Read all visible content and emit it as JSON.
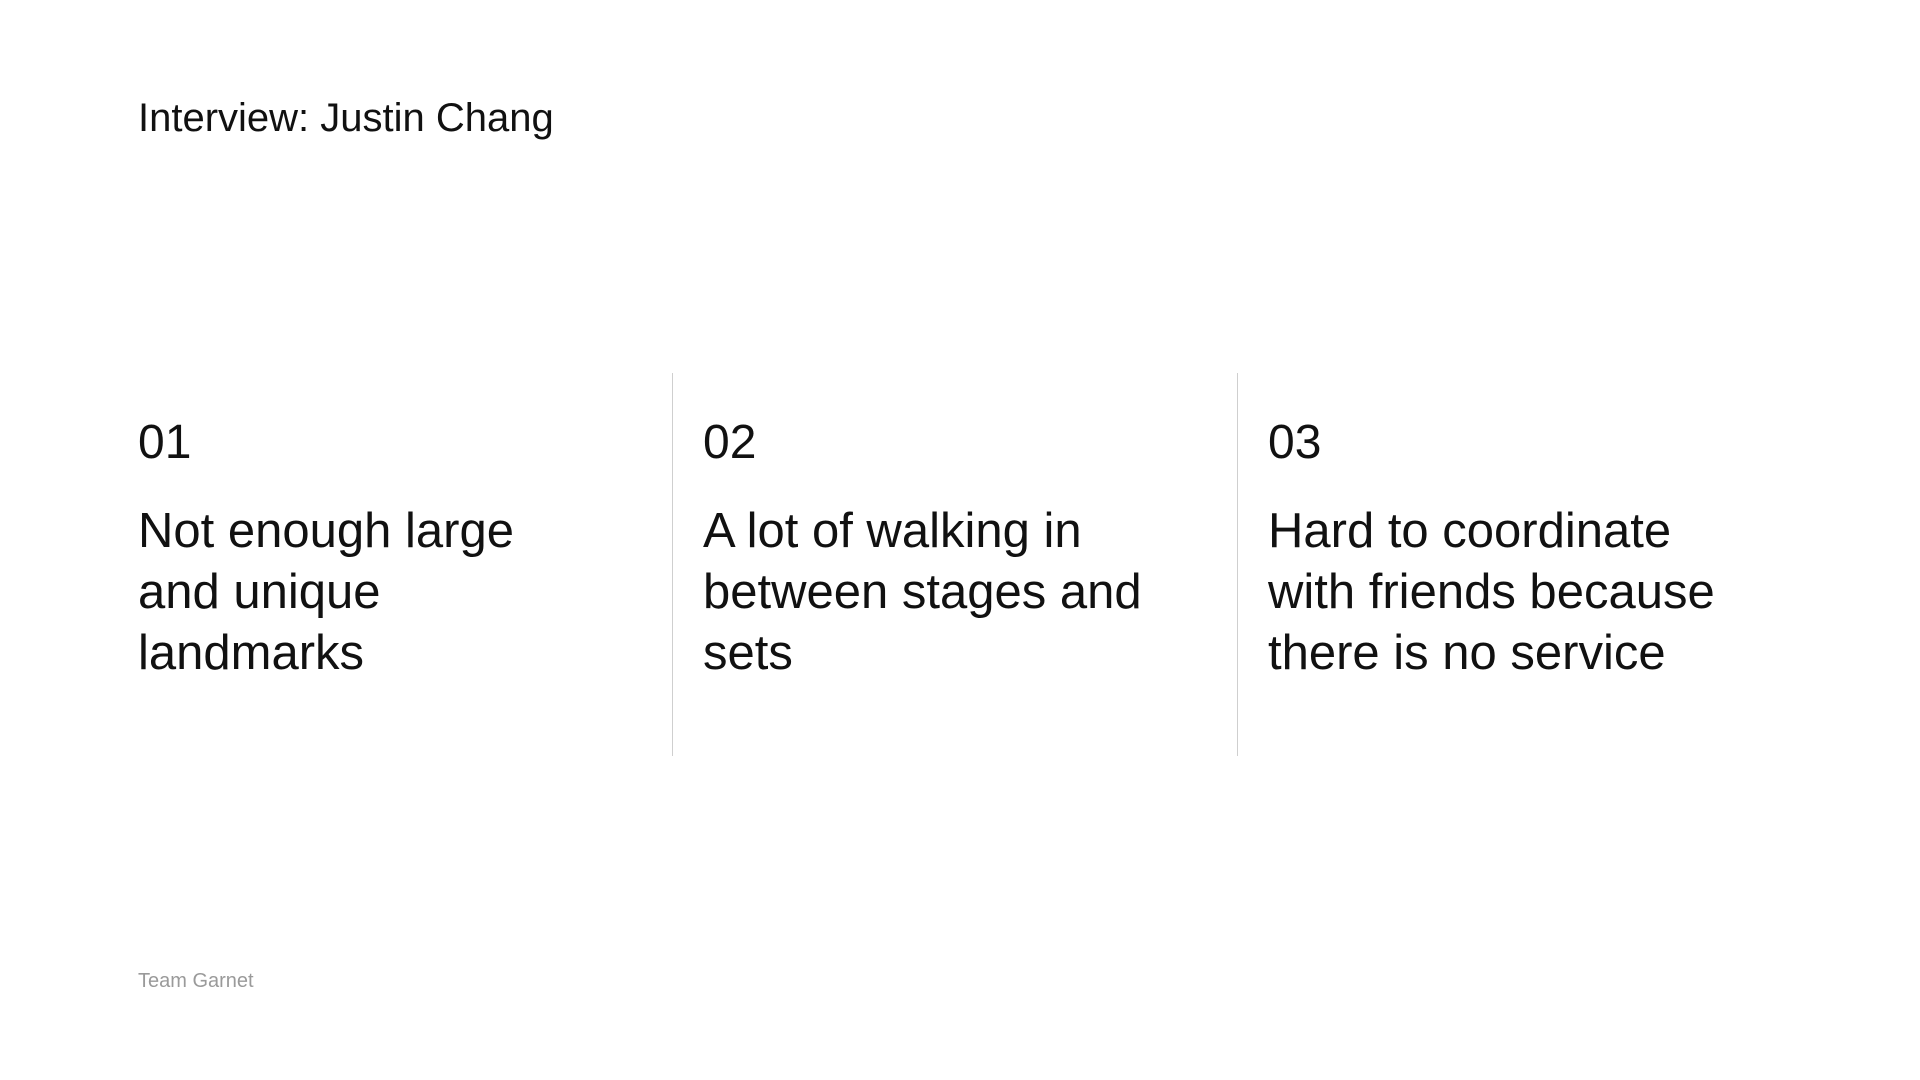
{
  "title": "Interview: Justin Chang",
  "points": [
    {
      "number": "01",
      "text": "Not enough large and unique landmarks"
    },
    {
      "number": "02",
      "text": "A lot of walking in between stages and sets"
    },
    {
      "number": "03",
      "text": "Hard to coordinate with friends because there is no service"
    }
  ],
  "footer": "Team Garnet",
  "colors": {
    "background": "#ffffff",
    "text": "#111111",
    "footer_text": "#9a9a9a",
    "divider": "#cfcfcf"
  }
}
